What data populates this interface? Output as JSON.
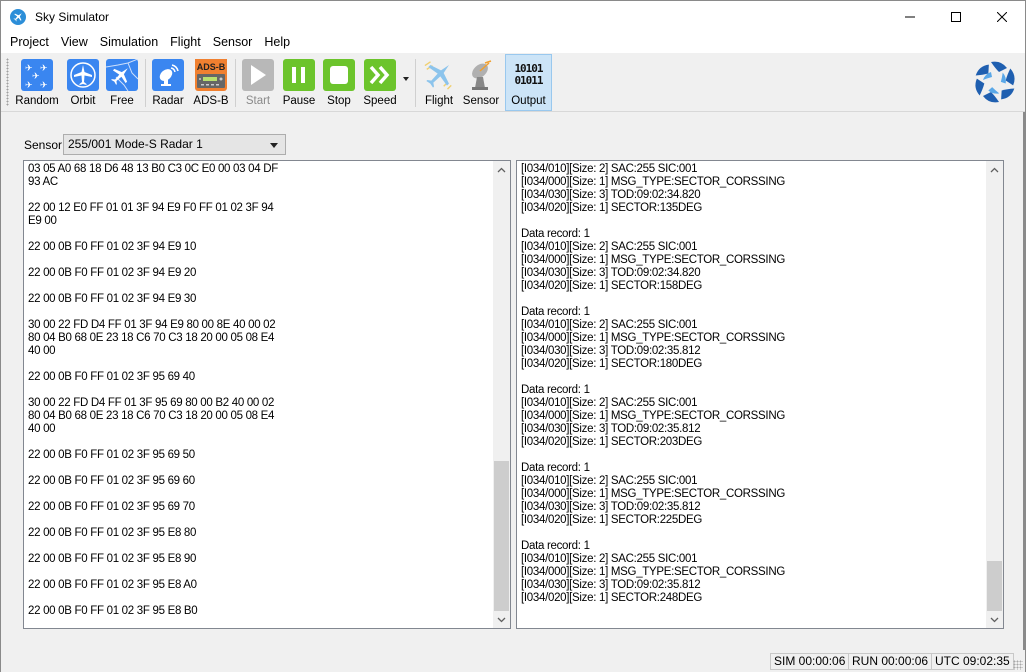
{
  "window": {
    "title": "Sky Simulator"
  },
  "menu": [
    "Project",
    "View",
    "Simulation",
    "Flight",
    "Sensor",
    "Help"
  ],
  "toolbar": {
    "random": "Random",
    "orbit": "Orbit",
    "free": "Free",
    "radar": "Radar",
    "adsb": "ADS-B",
    "adsb_icon_text": "ADS-B",
    "start": "Start",
    "pause": "Pause",
    "stop": "Stop",
    "speed": "Speed",
    "flight": "Flight",
    "sensor": "Sensor",
    "output": "Output",
    "output_icon_line1": "10101",
    "output_icon_line2": "01011"
  },
  "sensor": {
    "label": "Sensor",
    "selected": "255/001 Mode-S Radar 1"
  },
  "hex_output": [
    "03 05 A0 68 18 D6 48 13 B0 C3 0C E0 00 03 04 DF",
    "93 AC",
    "",
    "22 00 12 E0 FF 01 01 3F 94 E9 F0 FF 01 02 3F 94",
    "E9 00",
    "",
    "22 00 0B F0 FF 01 02 3F 94 E9 10",
    "",
    "22 00 0B F0 FF 01 02 3F 94 E9 20",
    "",
    "22 00 0B F0 FF 01 02 3F 94 E9 30",
    "",
    "30 00 22 FD D4 FF 01 3F 94 E9 80 00 8E 40 00 02",
    "80 04 B0 68 0E 23 18 C6 70 C3 18 20 00 05 08 E4",
    "40 00",
    "",
    "22 00 0B F0 FF 01 02 3F 95 69 40",
    "",
    "30 00 22 FD D4 FF 01 3F 95 69 80 00 B2 40 00 02",
    "80 04 B0 68 0E 23 18 C6 70 C3 18 20 00 05 08 E4",
    "40 00",
    "",
    "22 00 0B F0 FF 01 02 3F 95 69 50",
    "",
    "22 00 0B F0 FF 01 02 3F 95 69 60",
    "",
    "22 00 0B F0 FF 01 02 3F 95 69 70",
    "",
    "22 00 0B F0 FF 01 02 3F 95 E8 80",
    "",
    "22 00 0B F0 FF 01 02 3F 95 E8 90",
    "",
    "22 00 0B F0 FF 01 02 3F 95 E8 A0",
    "",
    "22 00 0B F0 FF 01 02 3F 95 E8 B0"
  ],
  "decoded_output": [
    "[I034/010][Size: 2] SAC:255 SIC:001",
    "[I034/000][Size: 1] MSG_TYPE:SECTOR_CORSSING",
    "[I034/030][Size: 3] TOD:09:02:34.820",
    "[I034/020][Size: 1] SECTOR:135DEG",
    "",
    "Data record: 1",
    "[I034/010][Size: 2] SAC:255 SIC:001",
    "[I034/000][Size: 1] MSG_TYPE:SECTOR_CORSSING",
    "[I034/030][Size: 3] TOD:09:02:34.820",
    "[I034/020][Size: 1] SECTOR:158DEG",
    "",
    "Data record: 1",
    "[I034/010][Size: 2] SAC:255 SIC:001",
    "[I034/000][Size: 1] MSG_TYPE:SECTOR_CORSSING",
    "[I034/030][Size: 3] TOD:09:02:35.812",
    "[I034/020][Size: 1] SECTOR:180DEG",
    "",
    "Data record: 1",
    "[I034/010][Size: 2] SAC:255 SIC:001",
    "[I034/000][Size: 1] MSG_TYPE:SECTOR_CORSSING",
    "[I034/030][Size: 3] TOD:09:02:35.812",
    "[I034/020][Size: 1] SECTOR:203DEG",
    "",
    "Data record: 1",
    "[I034/010][Size: 2] SAC:255 SIC:001",
    "[I034/000][Size: 1] MSG_TYPE:SECTOR_CORSSING",
    "[I034/030][Size: 3] TOD:09:02:35.812",
    "[I034/020][Size: 1] SECTOR:225DEG",
    "",
    "Data record: 1",
    "[I034/010][Size: 2] SAC:255 SIC:001",
    "[I034/000][Size: 1] MSG_TYPE:SECTOR_CORSSING",
    "[I034/030][Size: 3] TOD:09:02:35.812",
    "[I034/020][Size: 1] SECTOR:248DEG"
  ],
  "status": {
    "sim": "SIM 00:00:06",
    "run": "RUN 00:00:06",
    "utc": "UTC 09:02:35"
  },
  "colors": {
    "blue_icon": "#3a86f0",
    "green_icon": "#6cc42c",
    "disabled_icon": "#b8b8b8",
    "active_bg": "#cce4f7"
  }
}
